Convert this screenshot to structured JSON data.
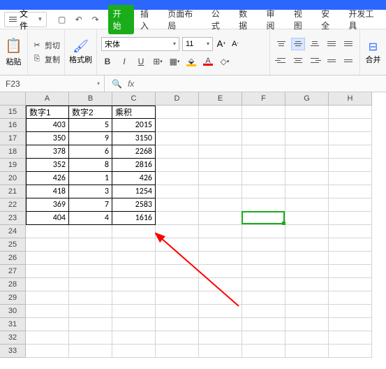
{
  "topbar": {},
  "menubar": {
    "file_label": "文件",
    "tabs": [
      "开始",
      "插入",
      "页面布局",
      "公式",
      "数据",
      "审阅",
      "视图",
      "安全",
      "开发工具"
    ]
  },
  "ribbon": {
    "paste": "粘贴",
    "cut": "剪切",
    "copy": "复制",
    "format_painter": "格式刷",
    "font_name": "宋体",
    "font_size": "11",
    "bold": "B",
    "italic": "I",
    "underline": "U",
    "merge": "合并"
  },
  "namebox": {
    "cell_ref": "F23",
    "fx": "fx"
  },
  "sheet": {
    "cols": [
      "A",
      "B",
      "C",
      "D",
      "E",
      "F",
      "G",
      "H"
    ],
    "first_row": 15,
    "headers": {
      "A": "数字1",
      "B": "数字2",
      "C": "乘积"
    },
    "data": [
      {
        "A": 403,
        "B": 5,
        "C": 2015
      },
      {
        "A": 350,
        "B": 9,
        "C": 3150
      },
      {
        "A": 378,
        "B": 6,
        "C": 2268
      },
      {
        "A": 352,
        "B": 8,
        "C": 2816
      },
      {
        "A": 426,
        "B": 1,
        "C": 426
      },
      {
        "A": 418,
        "B": 3,
        "C": 1254
      },
      {
        "A": 369,
        "B": 7,
        "C": 2583
      },
      {
        "A": 404,
        "B": 4,
        "C": 1616
      }
    ],
    "last_row": 33,
    "selected": "F23"
  }
}
